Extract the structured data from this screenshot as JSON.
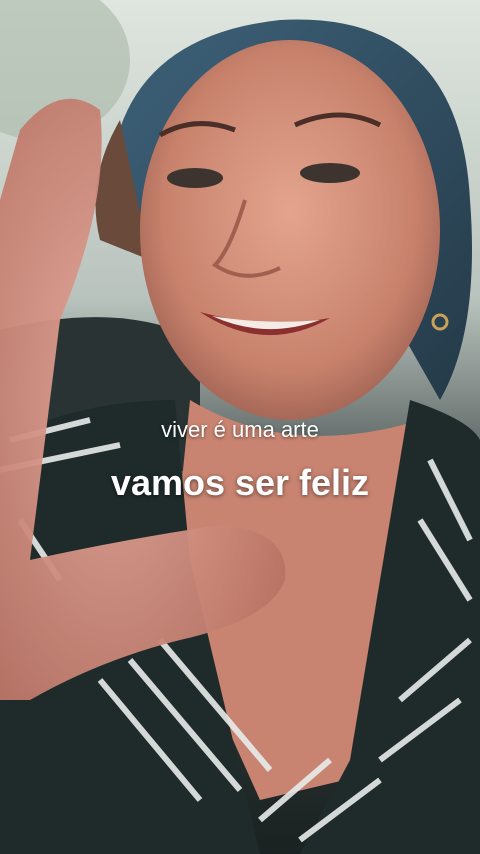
{
  "caption": {
    "line1": "viver é uma arte",
    "line2": "vamos ser feliz"
  },
  "colors": {
    "caption_text": "#ffffff",
    "shirt": "#1f2b2b",
    "shirt_stripes": "#e8ecea",
    "hair": "#2e4a5e"
  }
}
